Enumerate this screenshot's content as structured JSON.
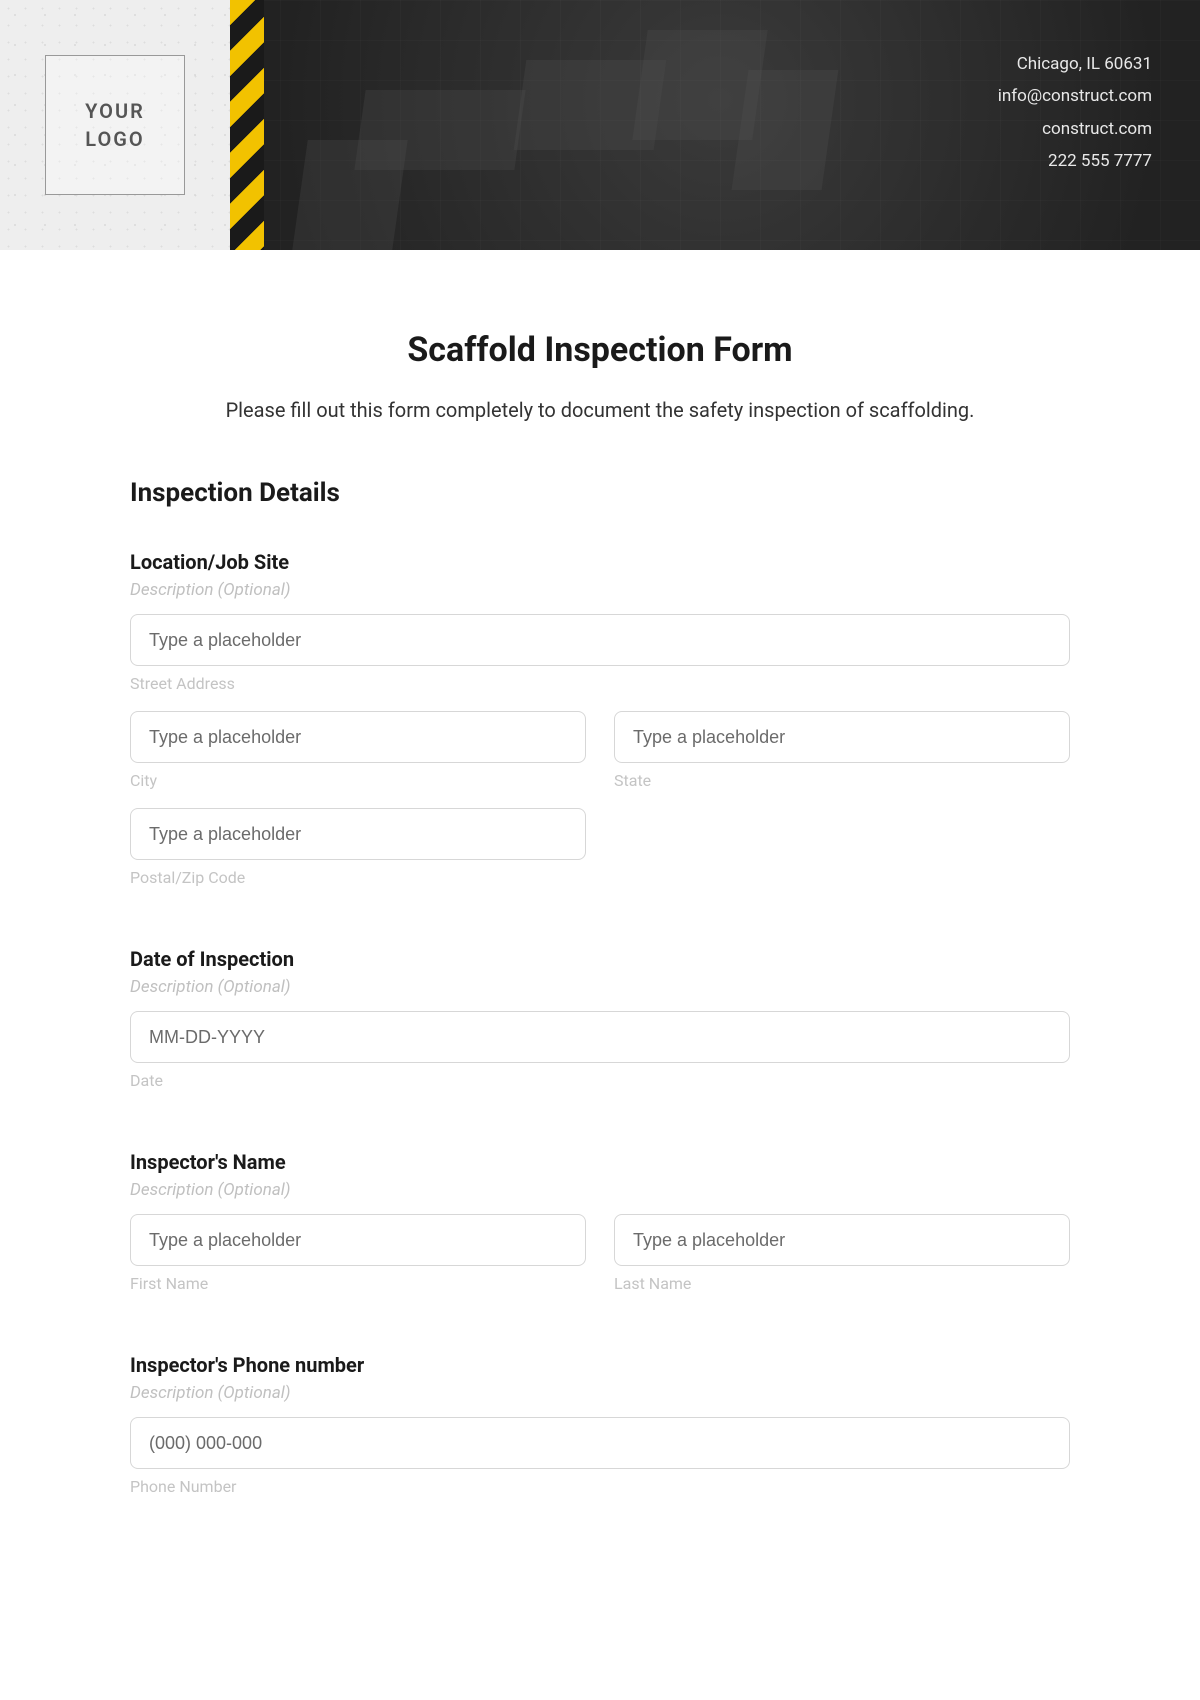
{
  "header": {
    "logo_text": "YOUR\nLOGO",
    "contact": {
      "line1": "Chicago, IL 60631",
      "line2": "info@construct.com",
      "line3": "construct.com",
      "line4": "222 555 7777"
    }
  },
  "form": {
    "title": "Scaffold Inspection Form",
    "subtitle": "Please fill out this form completely to document the safety inspection of scaffolding.",
    "section_title": "Inspection Details",
    "desc_optional": "Description (Optional)",
    "placeholder_generic": "Type a placeholder",
    "location": {
      "label": "Location/Job Site",
      "street_sub": "Street Address",
      "city_sub": "City",
      "state_sub": "State",
      "zip_sub": "Postal/Zip Code"
    },
    "date": {
      "label": "Date of Inspection",
      "placeholder": "MM-DD-YYYY",
      "sub": "Date"
    },
    "inspector": {
      "label": "Inspector's Name",
      "first_sub": "First Name",
      "last_sub": "Last Name"
    },
    "phone": {
      "label": "Inspector's Phone number",
      "placeholder": "(000) 000-000",
      "sub": "Phone Number"
    }
  }
}
